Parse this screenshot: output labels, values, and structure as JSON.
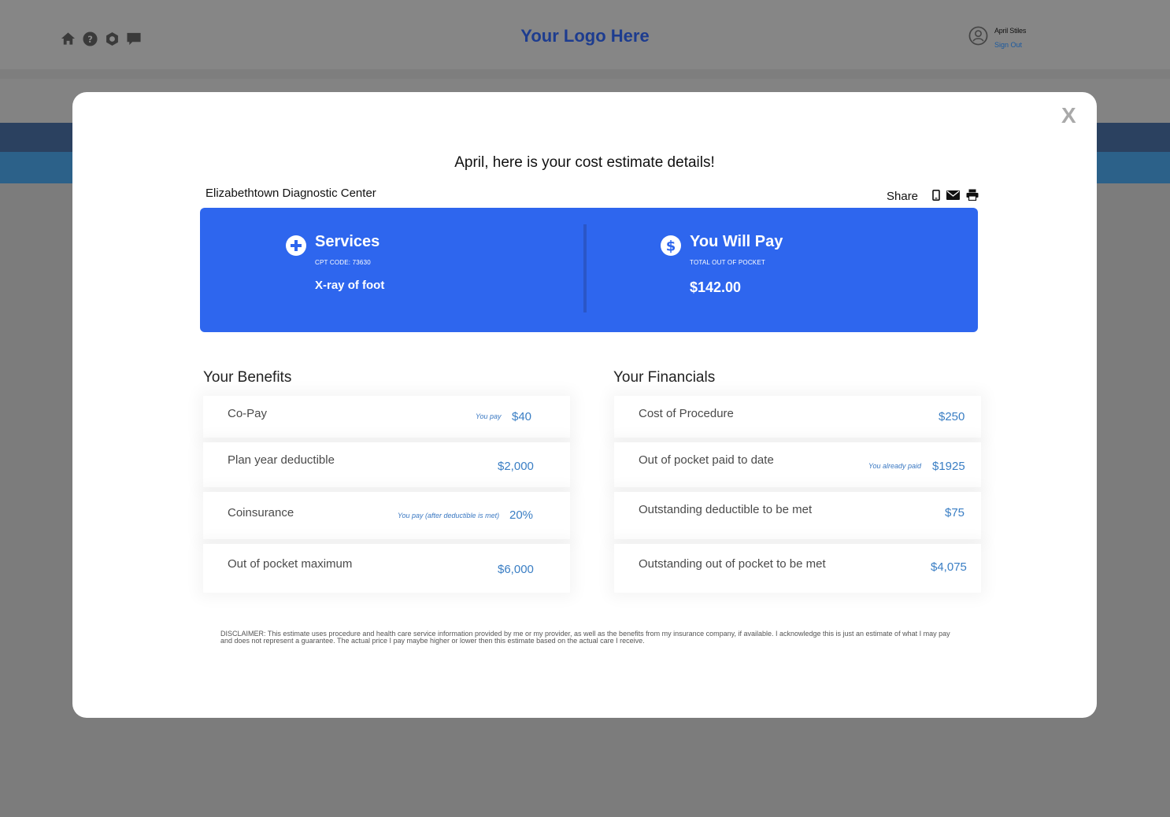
{
  "header": {
    "logo": "Your Logo Here",
    "user_name": "April Stiles",
    "sign_out": "Sign Out"
  },
  "modal": {
    "close": "X",
    "headline": "April, here is your cost estimate details!",
    "provider": "Elizabethtown Diagnostic Center",
    "share_label": "Share"
  },
  "summary": {
    "services_title": "Services",
    "cpt_code": "CPT CODE: 73630",
    "service_name": "X-ray of foot",
    "pay_title": "You Will Pay",
    "pay_sub": "TOTAL OUT OF POCKET",
    "pay_amount": "$142.00"
  },
  "benefits": {
    "title": "Your Benefits",
    "items": [
      {
        "label": "Co-Pay",
        "note": "You pay",
        "value": "$40"
      },
      {
        "label": "Plan year deductible",
        "note": "",
        "value": "$2,000"
      },
      {
        "label": "Coinsurance",
        "note": "You pay (after deductible is met)",
        "value": "20%"
      },
      {
        "label": "Out of pocket maximum",
        "note": "",
        "value": "$6,000"
      }
    ]
  },
  "financials": {
    "title": "Your Financials",
    "items": [
      {
        "label": "Cost of Procedure",
        "note": "",
        "value": "$250"
      },
      {
        "label": "Out of pocket paid to date",
        "note": "You already paid",
        "value": "$1925"
      },
      {
        "label": "Outstanding deductible to be met",
        "note": "",
        "value": "$75"
      },
      {
        "label": "Outstanding out of pocket to be met",
        "note": "",
        "value": "$4,075"
      }
    ]
  },
  "disclaimer": "DISCLAIMER: This estimate uses procedure and health care service information provided by me or my provider, as well as the benefits from my insurance company, if available. I acknowledge this is just an estimate of what I may pay and does not represent a guarantee. The actual price I pay maybe higher or lower then this estimate based on the actual care I receive.",
  "colors": {
    "accent": "#2e66ee",
    "value_blue": "#3a7ec4",
    "logo_blue": "#1d3c8f"
  },
  "icons": [
    "home-icon",
    "help-icon",
    "settings-icon",
    "chat-icon",
    "user-icon",
    "mobile-icon",
    "email-icon",
    "print-icon",
    "plus-icon",
    "dollar-icon"
  ]
}
